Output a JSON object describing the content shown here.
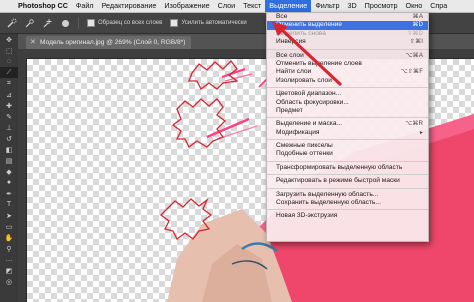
{
  "menubar": {
    "apple_glyph": "",
    "items": [
      {
        "label": "Photoshop CC"
      },
      {
        "label": "Файл"
      },
      {
        "label": "Редактирование"
      },
      {
        "label": "Изображение"
      },
      {
        "label": "Слои"
      },
      {
        "label": "Текст"
      },
      {
        "label": "Выделение"
      },
      {
        "label": "Фильтр"
      },
      {
        "label": "3D"
      },
      {
        "label": "Просмотр"
      },
      {
        "label": "Окно"
      },
      {
        "label": "Спра"
      }
    ]
  },
  "options_bar": {
    "checkbox1_label": "Образец со всех слоев",
    "checkbox2_label": "Усилить автоматически"
  },
  "document": {
    "tab_title": "Модель оригинал.jpg @ 269% (Слой 0, RGB/8*)",
    "close_glyph": "✕"
  },
  "dropdown": {
    "groups": [
      [
        {
          "label": "Все",
          "shortcut": "⌘A",
          "state": "normal"
        },
        {
          "label": "Отменить выделение",
          "shortcut": "⌘D",
          "state": "highlighted"
        },
        {
          "label": "Выделить снова",
          "shortcut": "⇧⌘D",
          "state": "disabled"
        },
        {
          "label": "Инверсия",
          "shortcut": "⇧⌘I",
          "state": "normal"
        }
      ],
      [
        {
          "label": "Все слои",
          "shortcut": "⌥⌘A",
          "state": "normal"
        },
        {
          "label": "Отменить выделение слоев",
          "shortcut": "",
          "state": "normal"
        },
        {
          "label": "Найти слои",
          "shortcut": "⌥⇧⌘F",
          "state": "normal"
        },
        {
          "label": "Изолировать слои",
          "shortcut": "",
          "state": "normal"
        }
      ],
      [
        {
          "label": "Цветовой диапазон...",
          "shortcut": "",
          "state": "normal"
        },
        {
          "label": "Область фокусировки...",
          "shortcut": "",
          "state": "normal"
        },
        {
          "label": "Предмет",
          "shortcut": "",
          "state": "normal"
        }
      ],
      [
        {
          "label": "Выделение и маска...",
          "shortcut": "⌥⌘R",
          "state": "normal"
        },
        {
          "label": "Модификация",
          "shortcut": "▸",
          "state": "normal"
        }
      ],
      [
        {
          "label": "Смежные пикселы",
          "shortcut": "",
          "state": "normal"
        },
        {
          "label": "Подобные оттенки",
          "shortcut": "",
          "state": "normal"
        }
      ],
      [
        {
          "label": "Трансформировать выделенную область",
          "shortcut": "",
          "state": "normal"
        }
      ],
      [
        {
          "label": "Редактировать в режиме быстрой маски",
          "shortcut": "",
          "state": "normal"
        }
      ],
      [
        {
          "label": "Загрузить выделенную область...",
          "shortcut": "",
          "state": "normal"
        },
        {
          "label": "Сохранить выделенную область...",
          "shortcut": "",
          "state": "normal"
        }
      ],
      [
        {
          "label": "Новая 3D-экструзия",
          "shortcut": "",
          "state": "normal"
        }
      ]
    ]
  },
  "colors": {
    "menu_highlight": "#3d72e0",
    "annotation_red": "#d9252f",
    "hair_pink": "#f0466c"
  }
}
